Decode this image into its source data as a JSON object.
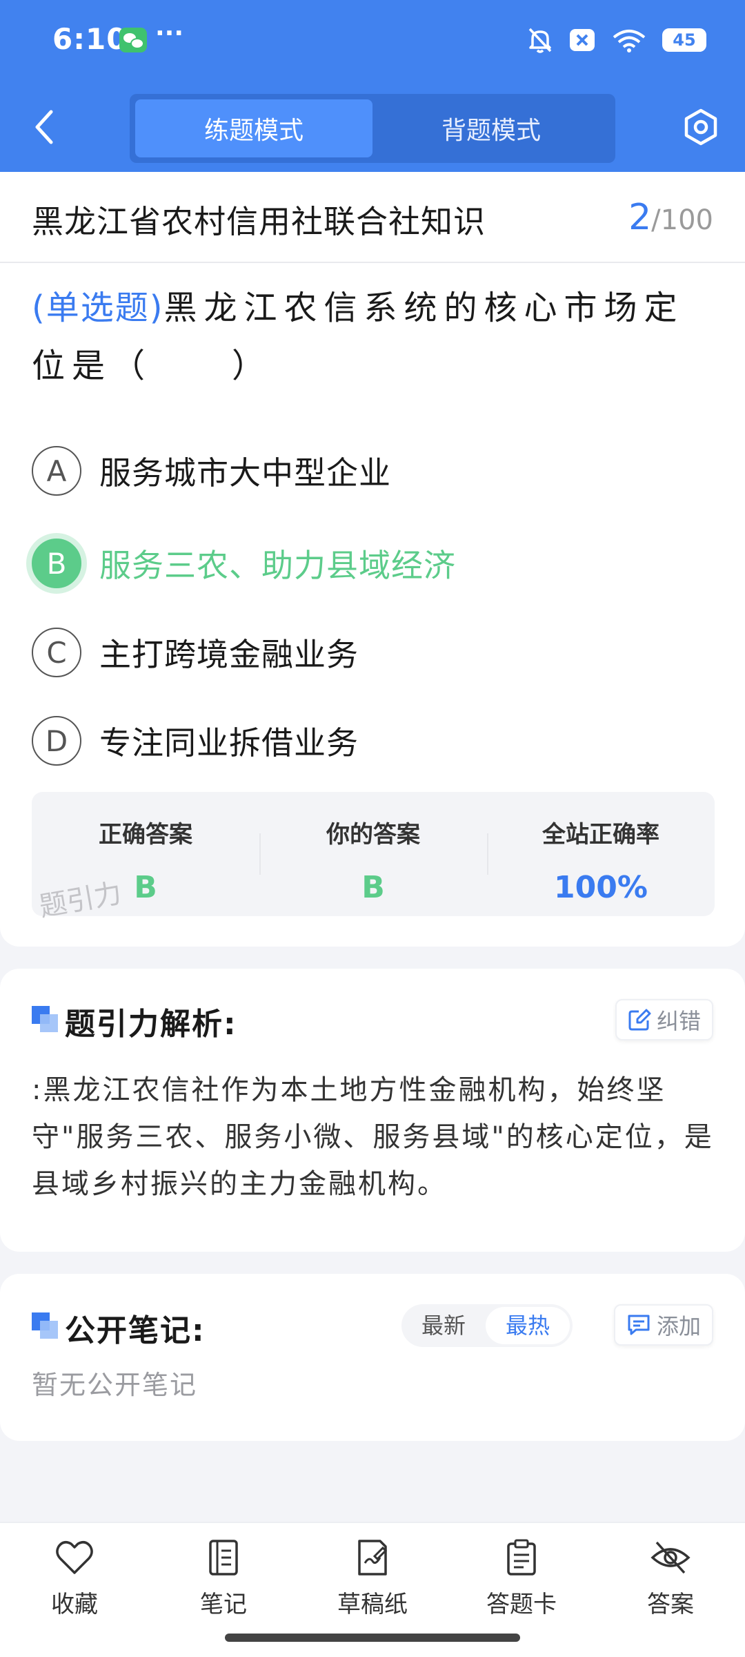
{
  "status_bar": {
    "time": "6:10",
    "more": "···",
    "battery": "45"
  },
  "header": {
    "tabs": [
      "练题模式",
      "背题模式"
    ],
    "active_tab": "练题模式"
  },
  "question_card": {
    "subject": "黑龙江省农村信用社联合社知识",
    "progress": {
      "current": "2",
      "total": "/100"
    },
    "type": "(单选题)",
    "question": "黑龙江农信系统的核心市场定位是（　　）",
    "options": [
      {
        "letter": "A",
        "text": "服务城市大中型企业",
        "state": "normal"
      },
      {
        "letter": "B",
        "text": "服务三农、助力县域经济",
        "state": "correct"
      },
      {
        "letter": "C",
        "text": "主打跨境金融业务",
        "state": "normal"
      },
      {
        "letter": "D",
        "text": "专注同业拆借业务",
        "state": "normal"
      }
    ],
    "answers": {
      "correct_label": "正确答案",
      "correct_value": "B",
      "yours_label": "你的答案",
      "yours_value": "B",
      "rate_label": "全站正确率",
      "rate_value": "100%"
    },
    "watermark": "题引力"
  },
  "analysis": {
    "title": "题引力解析:",
    "correct_button": "纠错",
    "text": ":黑龙江农信社作为本土地方性金融机构，始终坚守\"服务三农、服务小微、服务县域\"的核心定位，是县域乡村振兴的主力金融机构。"
  },
  "notes": {
    "title": "公开笔记:",
    "sort_options": [
      "最新",
      "最热"
    ],
    "active_sort": "最热",
    "add_button": "添加",
    "empty_text": "暂无公开笔记"
  },
  "bottom_bar": [
    {
      "label": "收藏",
      "icon": "heart-icon"
    },
    {
      "label": "笔记",
      "icon": "notebook-icon"
    },
    {
      "label": "草稿纸",
      "icon": "draft-icon"
    },
    {
      "label": "答题卡",
      "icon": "answer-sheet-icon"
    },
    {
      "label": "答案",
      "icon": "eye-off-icon"
    }
  ],
  "colors": {
    "primary": "#4182ef",
    "correct": "#5ccc8a",
    "accent_blue": "#3a7bf0"
  }
}
